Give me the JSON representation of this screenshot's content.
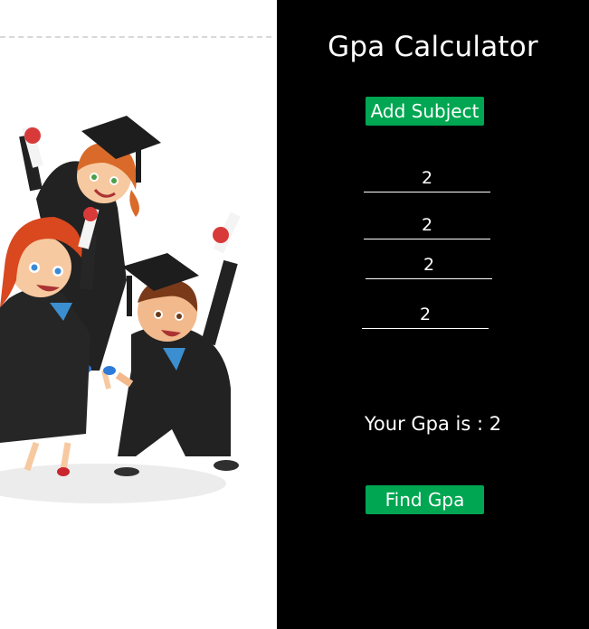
{
  "app": {
    "title": "Gpa Calculator",
    "add_subject_label": "Add Subject",
    "find_gpa_label": "Find Gpa"
  },
  "subjects": [
    {
      "value": "2"
    },
    {
      "value": "2"
    },
    {
      "value": "2"
    },
    {
      "value": "2"
    }
  ],
  "result": {
    "label": "Your Gpa is :",
    "value": "2"
  },
  "colors": {
    "accent": "#00a651",
    "panel_background": "#000000",
    "left_background": "#ffffff"
  },
  "illustration": {
    "icon": "graduates-illustration"
  }
}
